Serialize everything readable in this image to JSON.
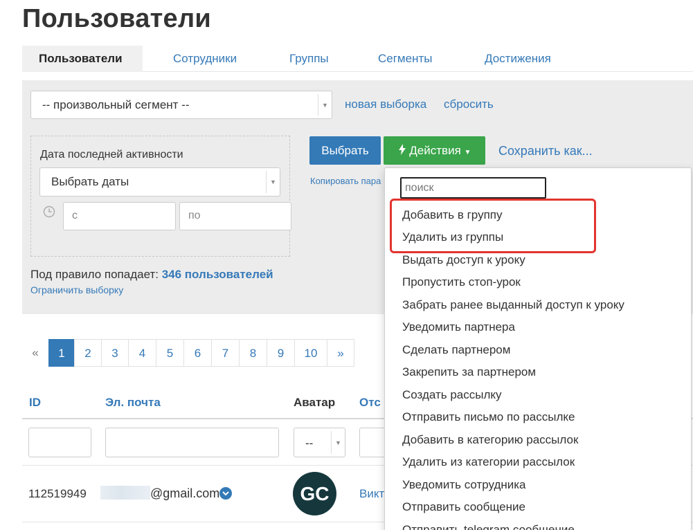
{
  "page": {
    "title": "Пользователи"
  },
  "tabs": [
    {
      "label": "Пользователи"
    },
    {
      "label": "Сотрудники"
    },
    {
      "label": "Группы"
    },
    {
      "label": "Сегменты"
    },
    {
      "label": "Достижения"
    }
  ],
  "filter": {
    "segment_select": "-- произвольный сегмент --",
    "new_selection_link": "новая выборка",
    "reset_link": "сбросить",
    "date_rule": {
      "label": "Дата последней активности",
      "select_value": "Выбрать даты",
      "from_placeholder": "с",
      "to_placeholder": "по"
    },
    "match_label": "Под правило попадает:",
    "match_count": "346 пользователей",
    "limit_link": "Ограничить выборку",
    "copy_link": "Копировать пара"
  },
  "actions": {
    "select_button": "Выбрать",
    "actions_button": "Действия",
    "save_as_link": "Сохранить как..."
  },
  "dropdown": {
    "search_placeholder": "поиск",
    "items": [
      "Добавить в группу",
      "Удалить из группы",
      "Выдать доступ к уроку",
      "Пропустить стоп-урок",
      "Забрать ранее выданный доступ к уроку",
      "Уведомить партнера",
      "Сделать партнером",
      "Закрепить за партнером",
      "Создать рассылку",
      "Отправить письмо по рассылке",
      "Добавить в категорию рассылок",
      "Удалить из категории рассылок",
      "Уведомить сотрудника",
      "Отправить сообщение",
      "Отправить telegram сообщение"
    ],
    "highlight_color": "#e2342f"
  },
  "pagination": {
    "prev": "«",
    "pages": [
      "1",
      "2",
      "3",
      "4",
      "5",
      "6",
      "7",
      "8",
      "9",
      "10"
    ],
    "next": "»",
    "current": "1"
  },
  "table": {
    "headers": {
      "id": "ID",
      "email": "Эл. почта",
      "avatar": "Аватар",
      "source": "Отс"
    },
    "avatar_filter_value": "--",
    "rows": [
      {
        "id": "112519949",
        "email": "@gmail.com",
        "avatar_text": "GC",
        "source": "Викт"
      }
    ]
  },
  "colors": {
    "accent": "#337ab7",
    "success": "#3aa54a",
    "link": "#3579b8"
  }
}
